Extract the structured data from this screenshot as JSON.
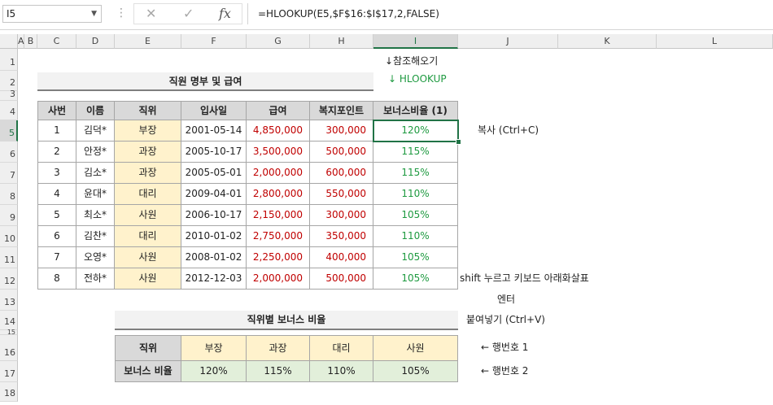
{
  "formula_bar": {
    "name_box": "I5",
    "cancel": "✕",
    "enter": "✓",
    "fx": "fx",
    "formula": "=HLOOKUP(E5,$F$16:$I$17,2,FALSE)"
  },
  "columns": [
    "A",
    "B",
    "C",
    "D",
    "E",
    "F",
    "G",
    "H",
    "I",
    "J",
    "K",
    "L"
  ],
  "rows": [
    "1",
    "2",
    "3",
    "4",
    "5",
    "6",
    "7",
    "8",
    "9",
    "10",
    "11",
    "12",
    "13",
    "14",
    "15",
    "16",
    "17",
    "18"
  ],
  "notes": {
    "ref_arrow": "↓참조해오기",
    "hlookup": "↓ HLOOKUP",
    "copy": "복사 (Ctrl+C)",
    "shift": "shift 누르고 키보드 아래화살표",
    "enter": "엔터",
    "paste": "붙여넣기 (Ctrl+V)",
    "row1": "← 행번호 1",
    "row2": "← 행번호 2"
  },
  "table1": {
    "title": "직원 명부 및 급여",
    "headers": [
      "사번",
      "이름",
      "직위",
      "입사일",
      "급여",
      "복지포인트",
      "보너스비율 (1)"
    ],
    "rows": [
      [
        "1",
        "김덕*",
        "부장",
        "2001-05-14",
        "4,850,000",
        "300,000",
        "120%"
      ],
      [
        "2",
        "안정*",
        "과장",
        "2005-10-17",
        "3,500,000",
        "500,000",
        "115%"
      ],
      [
        "3",
        "김소*",
        "과장",
        "2005-05-01",
        "2,000,000",
        "600,000",
        "115%"
      ],
      [
        "4",
        "윤대*",
        "대리",
        "2009-04-01",
        "2,800,000",
        "550,000",
        "110%"
      ],
      [
        "5",
        "최소*",
        "사원",
        "2006-10-17",
        "2,150,000",
        "300,000",
        "105%"
      ],
      [
        "6",
        "김찬*",
        "대리",
        "2010-01-02",
        "2,750,000",
        "350,000",
        "110%"
      ],
      [
        "7",
        "오영*",
        "사원",
        "2008-01-02",
        "2,250,000",
        "400,000",
        "105%"
      ],
      [
        "8",
        "전하*",
        "사원",
        "2012-12-03",
        "2,000,000",
        "500,000",
        "105%"
      ]
    ]
  },
  "table2": {
    "title": "직위별 보너스 비율",
    "row1": [
      "직위",
      "부장",
      "과장",
      "대리",
      "사원"
    ],
    "row2": [
      "보너스 비율",
      "120%",
      "115%",
      "110%",
      "105%"
    ]
  },
  "colors": {
    "accent": "#217346",
    "salary": "#c00000",
    "percent": "#1e9a40",
    "position_bg": "#fff2cc",
    "ratio_bg": "#e2efda",
    "header_bg": "#d9d9d9"
  }
}
